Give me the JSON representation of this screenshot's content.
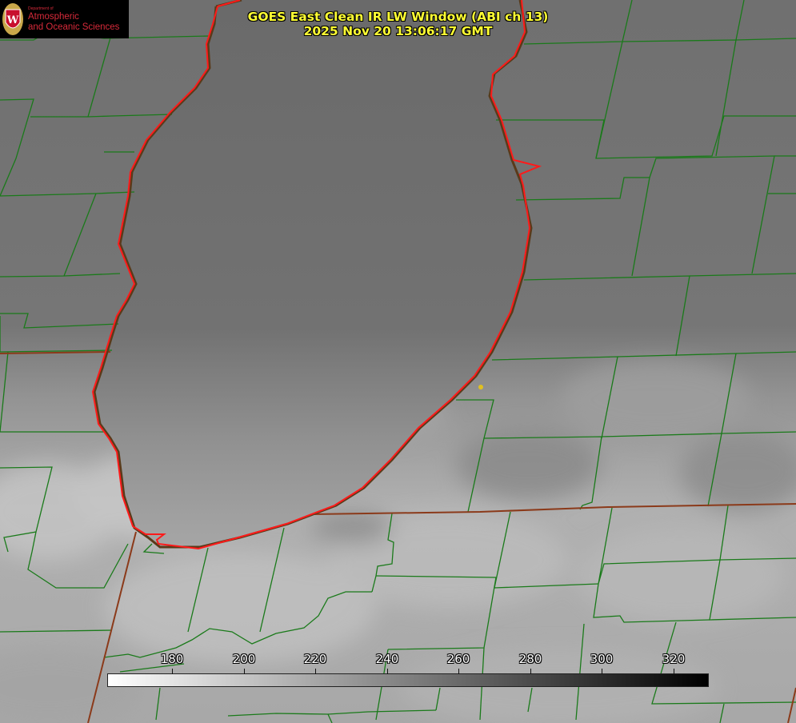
{
  "header": {
    "title_line1": "GOES East Clean IR LW Window (ABI ch 13)",
    "title_line2": "2025 Nov 20 13:06:17 GMT"
  },
  "logo": {
    "dept_small": "Department of",
    "line1": "Atmospheric",
    "line2": "and Oceanic Sciences",
    "seal_letter": "W",
    "color": "#d82a3a"
  },
  "colorbar": {
    "labels": [
      "180",
      "200",
      "220",
      "240",
      "260",
      "280",
      "300",
      "320"
    ],
    "gradient_from": "#ffffff",
    "gradient_to": "#000000"
  },
  "colors": {
    "title": "#ffff33",
    "county_lines": "#1a7a1a",
    "coastline": "#ff1a1a",
    "state_border": "#8b3a1a",
    "marker": "#e0c020"
  },
  "legend": {
    "colorbar_placement": "bottom"
  }
}
